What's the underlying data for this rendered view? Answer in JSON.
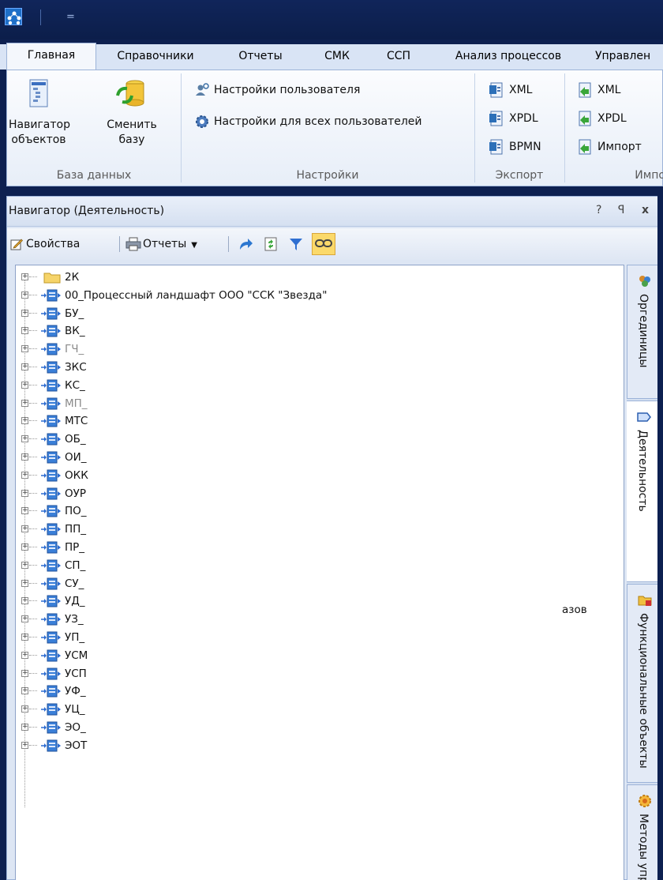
{
  "titlebar": {
    "qa_dropdown": "="
  },
  "ribbon_tabs": [
    {
      "label": "Главная",
      "selected": true
    },
    {
      "label": "Справочники"
    },
    {
      "label": "Отчеты"
    },
    {
      "label": "СМК"
    },
    {
      "label": "ССП"
    },
    {
      "label": "Анализ процессов"
    },
    {
      "label": "Управлен"
    }
  ],
  "ribbon": {
    "groups": {
      "database": {
        "label": "База данных",
        "nav_objects": "Навигатор\nобъектов",
        "change_db": "Сменить\nбазу"
      },
      "settings": {
        "label": "Настройки",
        "user_settings": "Настройки пользователя",
        "all_user_settings": "Настройки для всех пользователей"
      },
      "export": {
        "label": "Экспорт",
        "xml": "XML",
        "xpdl": "XPDL",
        "bpmn": "BPMN"
      },
      "import": {
        "label": "Импо",
        "xml": "XML",
        "xpdl": "XPDL",
        "import": "Импорт"
      }
    }
  },
  "panel": {
    "title": "Навигатор (Деятельность)",
    "help": "?",
    "pin": "ꟼ",
    "close": "x",
    "toolbar": {
      "properties": "Свойства",
      "reports": "Отчеты"
    }
  },
  "tree": [
    {
      "label": "2К",
      "type": "folder"
    },
    {
      "label": "00_Процессный ландшафт ООО \"ССК \"Звезда\"",
      "type": "process"
    },
    {
      "label": "БУ_",
      "type": "process"
    },
    {
      "label": "ВК_",
      "type": "process"
    },
    {
      "label": "ГЧ_",
      "type": "process",
      "gray": true
    },
    {
      "label": "ЗКС",
      "type": "process"
    },
    {
      "label": "КС_",
      "type": "process"
    },
    {
      "label": "МП_",
      "type": "process",
      "gray": true
    },
    {
      "label": "МТС",
      "type": "process"
    },
    {
      "label": "ОБ_",
      "type": "process"
    },
    {
      "label": "ОИ_",
      "type": "process"
    },
    {
      "label": "ОКК",
      "type": "process"
    },
    {
      "label": "ОУР",
      "type": "process"
    },
    {
      "label": "ПО_",
      "type": "process"
    },
    {
      "label": "ПП_",
      "type": "process"
    },
    {
      "label": "ПР_",
      "type": "process"
    },
    {
      "label": "СП_",
      "type": "process"
    },
    {
      "label": "СУ_",
      "type": "process"
    },
    {
      "label": "УД_",
      "type": "process"
    },
    {
      "label": "УЗ_",
      "type": "process"
    },
    {
      "label": "УП_",
      "type": "process"
    },
    {
      "label": "УСМ",
      "type": "process"
    },
    {
      "label": "УСП",
      "type": "process"
    },
    {
      "label": "УФ_",
      "type": "process"
    },
    {
      "label": "УЦ_",
      "type": "process"
    },
    {
      "label": "ЭО_",
      "type": "process"
    },
    {
      "label": "ЭОТ",
      "type": "process"
    }
  ],
  "floating_text": "азов",
  "side_tabs": [
    {
      "label": "Оргединицы",
      "icon": "org-units-icon"
    },
    {
      "label": "Деятельность",
      "icon": "activity-icon",
      "selected": true
    },
    {
      "label": "Функциональные объекты",
      "icon": "functional-objects-icon"
    },
    {
      "label": "Методы упр",
      "icon": "methods-icon"
    }
  ]
}
